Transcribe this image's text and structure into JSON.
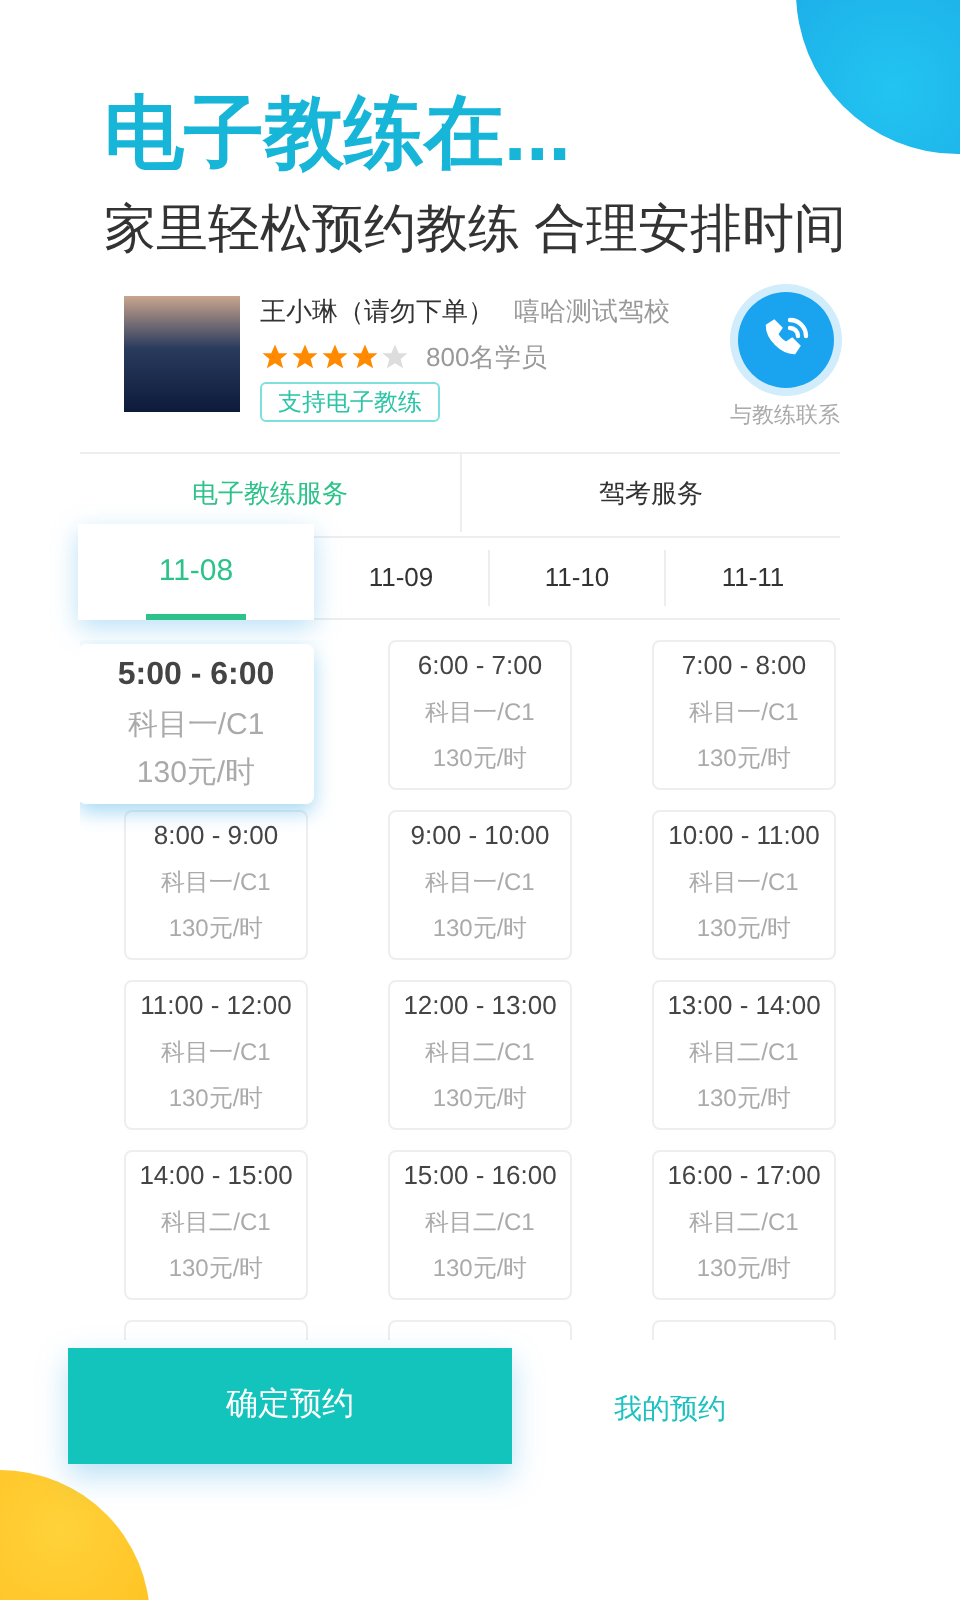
{
  "headline": "电子教练在...",
  "subtitle": "家里轻松预约教练 合理安排时间",
  "coach": {
    "name": "王小琳（请勿下单）",
    "school": "嘻哈测试驾校",
    "stars": 4,
    "students": "800名学员",
    "tag": "支持电子教练",
    "contact_label": "与教练联系"
  },
  "service_tabs": [
    {
      "label": "电子教练服务",
      "selected": true
    },
    {
      "label": "驾考服务",
      "selected": false
    }
  ],
  "date_tabs": [
    {
      "label": "11-08",
      "selected": true
    },
    {
      "label": "11-09",
      "selected": false
    },
    {
      "label": "11-10",
      "selected": false
    },
    {
      "label": "11-11",
      "selected": false
    }
  ],
  "slots": [
    {
      "time": "5:00 - 6:00",
      "subject": "科目一/C1",
      "price": "130元/时",
      "selected": true
    },
    {
      "time": "6:00 - 7:00",
      "subject": "科目一/C1",
      "price": "130元/时",
      "selected": false
    },
    {
      "time": "7:00 - 8:00",
      "subject": "科目一/C1",
      "price": "130元/时",
      "selected": false
    },
    {
      "time": "8:00 - 9:00",
      "subject": "科目一/C1",
      "price": "130元/时",
      "selected": false
    },
    {
      "time": "9:00 - 10:00",
      "subject": "科目一/C1",
      "price": "130元/时",
      "selected": false
    },
    {
      "time": "10:00 - 11:00",
      "subject": "科目一/C1",
      "price": "130元/时",
      "selected": false
    },
    {
      "time": "11:00 - 12:00",
      "subject": "科目一/C1",
      "price": "130元/时",
      "selected": false
    },
    {
      "time": "12:00 - 13:00",
      "subject": "科目二/C1",
      "price": "130元/时",
      "selected": false
    },
    {
      "time": "13:00 - 14:00",
      "subject": "科目二/C1",
      "price": "130元/时",
      "selected": false
    },
    {
      "time": "14:00 - 15:00",
      "subject": "科目二/C1",
      "price": "130元/时",
      "selected": false
    },
    {
      "time": "15:00 - 16:00",
      "subject": "科目二/C1",
      "price": "130元/时",
      "selected": false
    },
    {
      "time": "16:00 - 17:00",
      "subject": "科目二/C1",
      "price": "130元/时",
      "selected": false
    }
  ],
  "confirm_button": "确定预约",
  "my_bookings_link": "我的预约"
}
